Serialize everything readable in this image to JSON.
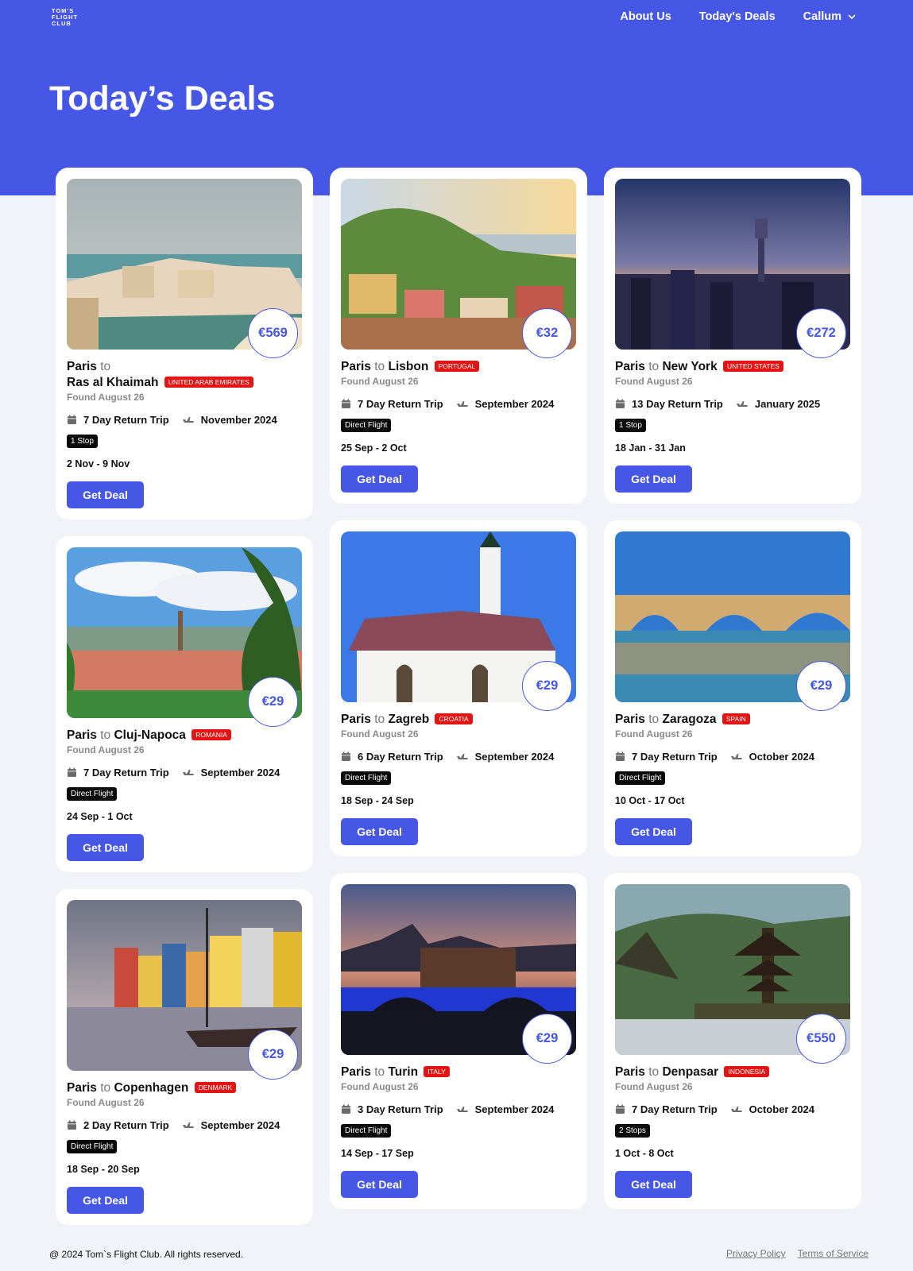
{
  "header": {
    "logo_lines": [
      "TOM'S",
      "FLIGHT",
      "CLUB"
    ],
    "nav": {
      "about": "About Us",
      "deals": "Today's Deals",
      "user": "Callum"
    }
  },
  "page_title": "Today’s Deals",
  "common": {
    "to": "to",
    "found": "Found August 26",
    "cta": "Get Deal"
  },
  "deals": [
    {
      "from": "Paris",
      "dest": "Ras al Khaimah",
      "country": "UNITED ARAB EMIRATES",
      "price": "€569",
      "trip": "7 Day Return Trip",
      "month": "November 2024",
      "stops": "1 Stop",
      "dates": "2 Nov - 9 Nov"
    },
    {
      "from": "Paris",
      "dest": "Lisbon",
      "country": "PORTUGAL",
      "price": "€32",
      "trip": "7 Day Return Trip",
      "month": "September 2024",
      "stops": "Direct Flight",
      "dates": "25 Sep - 2 Oct"
    },
    {
      "from": "Paris",
      "dest": "New York",
      "country": "UNITED STATES",
      "price": "€272",
      "trip": "13 Day Return Trip",
      "month": "January 2025",
      "stops": "1 Stop",
      "dates": "18 Jan - 31 Jan"
    },
    {
      "from": "Paris",
      "dest": "Cluj-Napoca",
      "country": "ROMANIA",
      "price": "€29",
      "trip": "7 Day Return Trip",
      "month": "September 2024",
      "stops": "Direct Flight",
      "dates": "24 Sep - 1 Oct"
    },
    {
      "from": "Paris",
      "dest": "Zagreb",
      "country": "CROATIA",
      "price": "€29",
      "trip": "6 Day Return Trip",
      "month": "September 2024",
      "stops": "Direct Flight",
      "dates": "18 Sep - 24 Sep"
    },
    {
      "from": "Paris",
      "dest": "Zaragoza",
      "country": "SPAIN",
      "price": "€29",
      "trip": "7 Day Return Trip",
      "month": "October 2024",
      "stops": "Direct Flight",
      "dates": "10 Oct - 17 Oct"
    },
    {
      "from": "Paris",
      "dest": "Copenhagen",
      "country": "DENMARK",
      "price": "€29",
      "trip": "2 Day Return Trip",
      "month": "September 2024",
      "stops": "Direct Flight",
      "dates": "18 Sep - 20 Sep"
    },
    {
      "from": "Paris",
      "dest": "Turin",
      "country": "ITALY",
      "price": "€29",
      "trip": "3 Day Return Trip",
      "month": "September 2024",
      "stops": "Direct Flight",
      "dates": "14 Sep - 17 Sep"
    },
    {
      "from": "Paris",
      "dest": "Denpasar",
      "country": "INDONESIA",
      "price": "€550",
      "trip": "7 Day Return Trip",
      "month": "October 2024",
      "stops": "2 Stops",
      "dates": "1 Oct - 8 Oct"
    }
  ],
  "footer": {
    "copyright": "@ 2024 Tom`s Flight Club. All rights reserved.",
    "privacy": "Privacy Policy",
    "terms": "Terms of Service"
  },
  "colors": {
    "brand": "#4557e4",
    "badge": "#e31414",
    "stop_badge": "#0a0a0a"
  }
}
